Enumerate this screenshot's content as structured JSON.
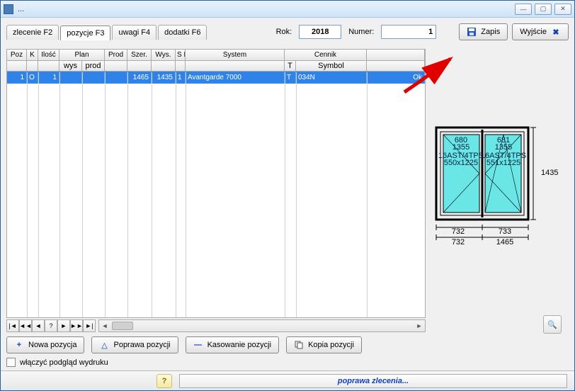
{
  "window": {
    "title": "..."
  },
  "tabs": [
    {
      "label": "zlecenie F2"
    },
    {
      "label": "pozycje F3"
    },
    {
      "label": "uwagi F4"
    },
    {
      "label": "dodatki F6"
    }
  ],
  "top": {
    "rok_label": "Rok:",
    "rok_value": "2018",
    "numer_label": "Numer:",
    "numer_value": "1",
    "zapis": "Zapis",
    "wyjscie": "Wyjście"
  },
  "table": {
    "headers": {
      "poz": "Poz",
      "k": "K",
      "ilosc": "Ilość",
      "plan": "Plan",
      "plan_wys": "wys",
      "plan_prod": "prod",
      "prod": "Prod",
      "szer": "Szer.",
      "wys": "Wys.",
      "sp": "S P",
      "system": "System",
      "cennik": "Cennik",
      "cennik_t": "T",
      "cennik_symbol": "Symbol"
    },
    "rows": [
      {
        "poz": "1",
        "k": "O",
        "ilosc": "1",
        "plan_wys": "",
        "plan_prod": "",
        "prod": "",
        "szer": "1465",
        "wys": "1435",
        "sp": "1",
        "system": "Avantgarde 7000",
        "t": "T",
        "symbol": "034N",
        "rest": "Ok"
      }
    ]
  },
  "nav": {
    "first": "|◄",
    "fastback": "◄◄",
    "back": "◄",
    "q": "?",
    "fwd": "►",
    "fastfwd": "►►",
    "last": "►|"
  },
  "actions": {
    "nowa": "Nowa pozycja",
    "poprawa": "Poprawa pozycji",
    "kasowanie": "Kasowanie pozycji",
    "kopia": "Kopia pozycji"
  },
  "checkbox": {
    "label": "włączyć podgląd wydruku"
  },
  "status": {
    "text": "poprawa zlecenia..."
  },
  "preview": {
    "pane_left": {
      "v1": "680",
      "v2": "1355",
      "v3": "16AST/4TPS",
      "v4": "550x1225"
    },
    "pane_right": {
      "v1": "681",
      "v2": "1355",
      "v3": "16AST/4TPS",
      "v4": "551x1225"
    },
    "height": "1435",
    "bottom_left": "732",
    "bottom_right": "733",
    "bottom2_left": "732",
    "bottom2_right": "1465"
  },
  "chart_data": {
    "type": "table",
    "title": "Pozycje",
    "columns": [
      "Poz",
      "K",
      "Ilość",
      "Plan wys",
      "Plan prod",
      "Prod",
      "Szer.",
      "Wys.",
      "S P",
      "System",
      "Cennik T",
      "Cennik Symbol"
    ],
    "rows": [
      [
        1,
        "O",
        1,
        null,
        null,
        null,
        1465,
        1435,
        1,
        "Avantgarde 7000",
        "T",
        "034N"
      ]
    ]
  }
}
